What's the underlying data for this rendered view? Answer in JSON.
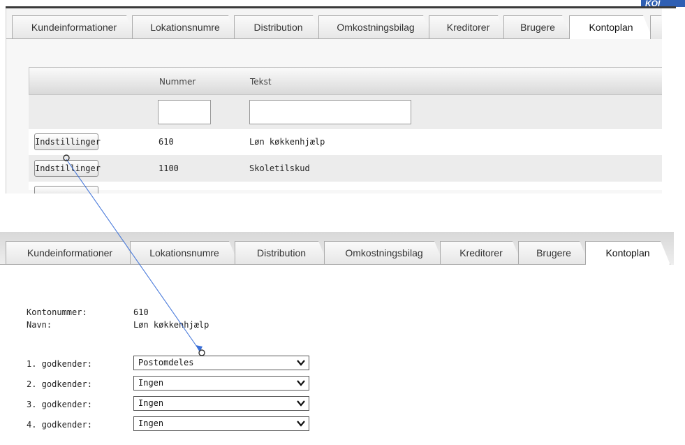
{
  "logo_text": "KOI",
  "tabs": [
    {
      "label": "Kundeinformationer",
      "active": false
    },
    {
      "label": "Lokationsnumre",
      "active": false
    },
    {
      "label": "Distribution",
      "active": false
    },
    {
      "label": "Omkostningsbilag",
      "active": false
    },
    {
      "label": "Kreditorer",
      "active": false
    },
    {
      "label": "Brugere",
      "active": false
    },
    {
      "label": "Kontoplan",
      "active": true
    }
  ],
  "account_grid": {
    "columns": {
      "number": "Nummer",
      "text": "Tekst"
    },
    "filter": {
      "number_value": "",
      "text_value": ""
    },
    "button_label": "Indstillinger",
    "rows": [
      {
        "number": "610",
        "text": "Løn køkkenhjælp"
      },
      {
        "number": "1100",
        "text": "Skoletilskud"
      }
    ]
  },
  "account_detail": {
    "account_number_label": "Kontonummer:",
    "account_number": "610",
    "name_label": "Navn:",
    "name": "Løn køkkenhjælp",
    "approvers": [
      {
        "label": "1. godkender:",
        "value": "Postomdeles"
      },
      {
        "label": "2. godkender:",
        "value": "Ingen"
      },
      {
        "label": "3. godkender:",
        "value": "Ingen"
      },
      {
        "label": "4. godkender:",
        "value": "Ingen"
      }
    ]
  },
  "colors": {
    "annotation_arrow": "#3a6fd8",
    "logo_bg": "#2f5fb3"
  },
  "icons": {
    "dropdown": "chevron-down-icon"
  }
}
